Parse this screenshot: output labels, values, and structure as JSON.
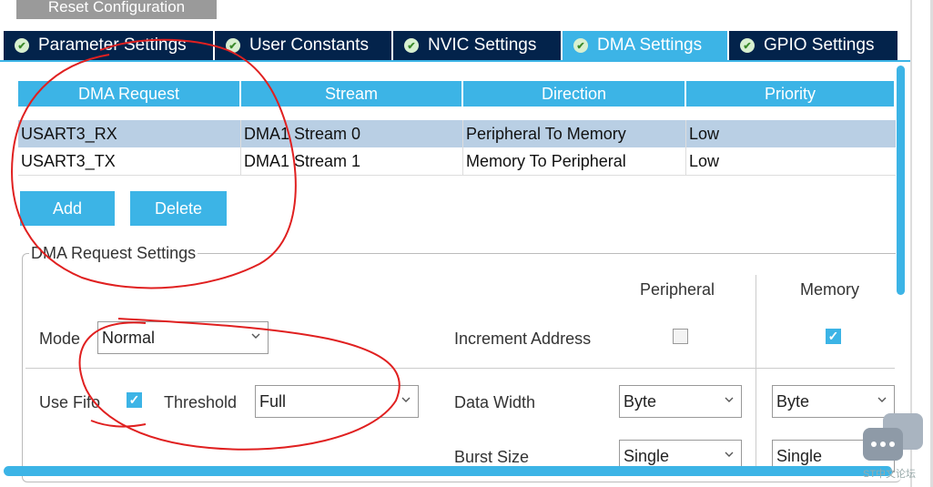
{
  "header": {
    "reset_label": "Reset Configuration"
  },
  "tabs": [
    {
      "label": "Parameter Settings"
    },
    {
      "label": "User Constants"
    },
    {
      "label": "NVIC Settings"
    },
    {
      "label": "DMA Settings",
      "active": true
    },
    {
      "label": "GPIO Settings"
    }
  ],
  "table": {
    "columns": [
      "DMA Request",
      "Stream",
      "Direction",
      "Priority"
    ],
    "rows": [
      {
        "request": "USART3_RX",
        "stream": "DMA1 Stream 0",
        "direction": "Peripheral To Memory",
        "priority": "Low",
        "selected": true
      },
      {
        "request": "USART3_TX",
        "stream": "DMA1 Stream 1",
        "direction": "Memory To Peripheral",
        "priority": "Low",
        "selected": false
      }
    ]
  },
  "buttons": {
    "add": "Add",
    "delete": "Delete"
  },
  "settings": {
    "legend": "DMA Request Settings",
    "peripheral_header": "Peripheral",
    "memory_header": "Memory",
    "mode_label": "Mode",
    "mode_value": "Normal",
    "increment_label": "Increment Address",
    "increment_peripheral": false,
    "increment_memory": true,
    "use_fifo_label": "Use Fifo",
    "use_fifo": true,
    "threshold_label": "Threshold",
    "threshold_value": "Full",
    "data_width_label": "Data Width",
    "data_width_peripheral": "Byte",
    "data_width_memory": "Byte",
    "burst_size_label": "Burst Size",
    "burst_size_peripheral": "Single",
    "burst_size_memory": "Single"
  },
  "watermark": "ST中文论坛",
  "colors": {
    "accent": "#3cb4e6",
    "tab_dark": "#03234b",
    "selected_row": "#b9cfe4",
    "annotation": "#e02020"
  }
}
